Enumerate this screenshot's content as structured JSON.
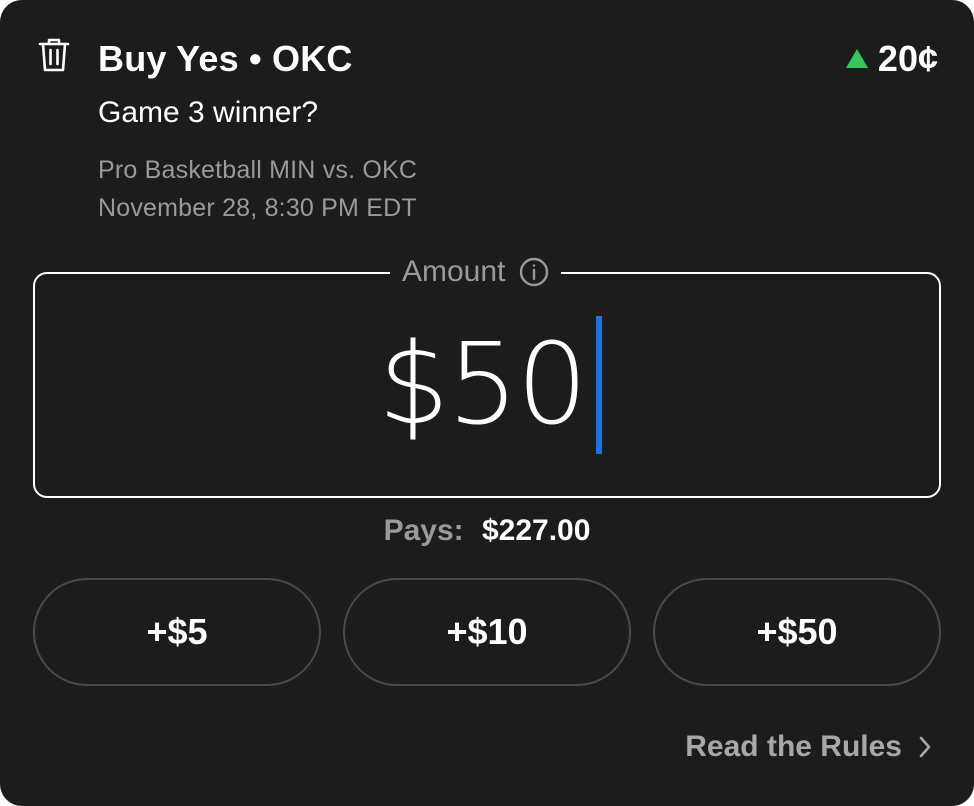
{
  "order": {
    "title": "Buy Yes • OKC",
    "price": "20¢",
    "question": "Game 3 winner?",
    "event": "Pro Basketball MIN vs. OKC",
    "datetime": "November 28, 8:30 PM EDT"
  },
  "amount": {
    "label": "Amount",
    "value": "$50"
  },
  "payout": {
    "label": "Pays:",
    "value": "$227.00"
  },
  "quick_add": [
    {
      "label": "+$5"
    },
    {
      "label": "+$10"
    },
    {
      "label": "+$50"
    }
  ],
  "rules_link": "Read the Rules",
  "colors": {
    "background": "#1c1c1c",
    "up_indicator": "#34c759",
    "caret": "#1a73e8",
    "muted_text": "#9a9a9a"
  },
  "icons": [
    "trash-icon",
    "price-up-icon",
    "info-icon",
    "chevron-right-icon"
  ]
}
